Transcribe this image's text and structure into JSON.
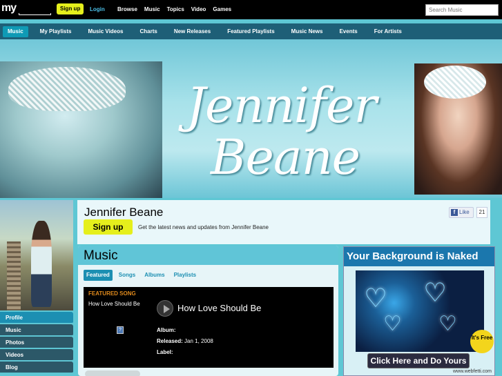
{
  "topbar": {
    "logo": "my",
    "signup": "Sign up",
    "login": "Login",
    "nav": [
      "Browse",
      "Music",
      "Topics",
      "Video",
      "Games"
    ],
    "search_placeholder": "Search Music"
  },
  "subnav": {
    "items": [
      "Music",
      "My Playlists",
      "Music Videos",
      "Charts",
      "New Releases",
      "Featured Playlists",
      "Music News",
      "Events",
      "For Artists"
    ],
    "active": "Music"
  },
  "banner": {
    "title_line1": "Jennifer",
    "title_line2": "Beane"
  },
  "left_menu": {
    "items": [
      "Profile",
      "Music",
      "Photos",
      "Videos",
      "Blog"
    ],
    "active": "Profile"
  },
  "profile": {
    "name": "Jennifer Beane",
    "signup": "Sign up",
    "description": "Get the latest news and updates from Jennifer Beane",
    "like_label": "Like",
    "like_count": "21"
  },
  "music": {
    "title": "Music",
    "tabs": [
      "Featured",
      "Songs",
      "Albums",
      "Playlists"
    ],
    "active_tab": "Featured",
    "featured_label": "FEATURED SONG",
    "song_small": "How Love Should Be",
    "song_title": "How Love Should Be",
    "album_label": "Album:",
    "album_value": "",
    "released_label": "Released:",
    "released_value": "Jan 1, 2008",
    "label_label": "Label:",
    "label_value": "",
    "qmark": "?"
  },
  "ad": {
    "headline": "Your Background is Naked",
    "free": "It's Free",
    "button": "Click Here and Do Yours",
    "url": "www.webfetti.com"
  },
  "colors": {
    "accent": "#e5ef1c",
    "subnav": "#1e5f77",
    "active_blue": "#1c8fb2",
    "background": "#5ec7d4"
  }
}
